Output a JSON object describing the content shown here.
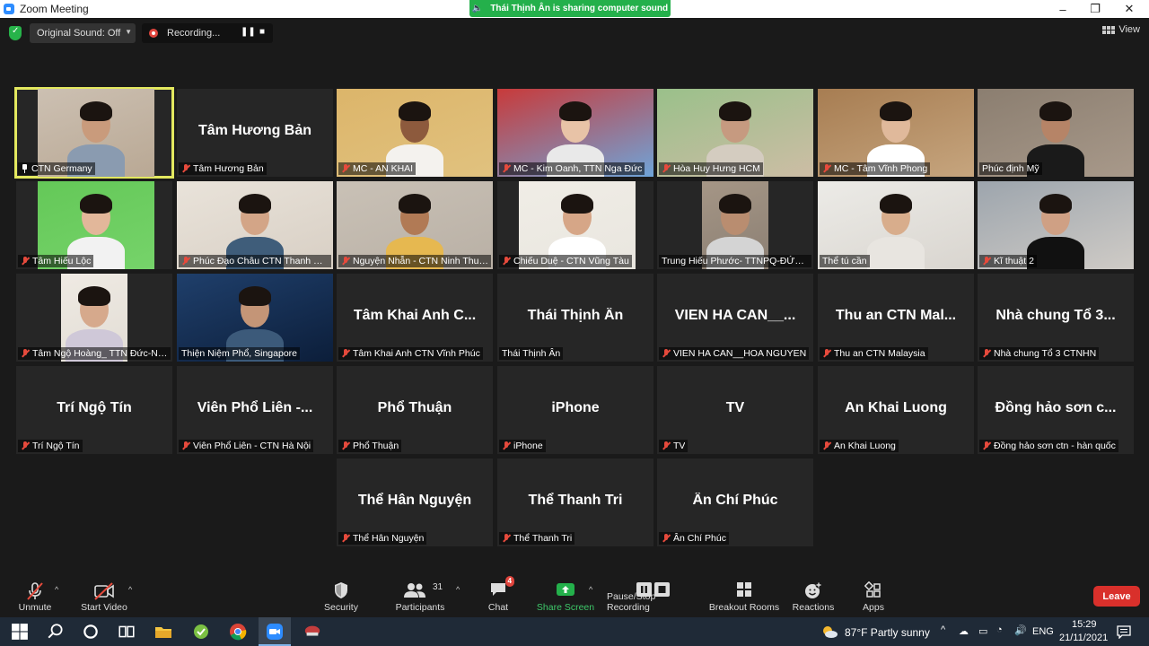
{
  "window": {
    "title": "Zoom Meeting",
    "minimize": "–",
    "maximize": "❐",
    "close": "✕"
  },
  "banner": {
    "text": "Thái Thịnh Ân is sharing computer sound"
  },
  "topbar": {
    "original_sound": "Original Sound: Off",
    "recording": "Recording...",
    "view": "View"
  },
  "participants": [
    {
      "name": "CTN Germany",
      "big": "",
      "video": true,
      "muted": false,
      "pinned": true,
      "active": true
    },
    {
      "name": "Tâm Hương Bản",
      "big": "Tâm Hương Bản",
      "video": false,
      "muted": true
    },
    {
      "name": "MC - AN KHAI",
      "big": "",
      "video": true,
      "muted": true
    },
    {
      "name": "MC - Kim Oanh, TTN Nga Đức",
      "big": "",
      "video": true,
      "muted": true
    },
    {
      "name": "Hòa Huy Hưng HCM",
      "big": "",
      "video": true,
      "muted": true
    },
    {
      "name": "MC - Tâm Vĩnh Phong",
      "big": "",
      "video": true,
      "muted": true
    },
    {
      "name": "Phúc định Mỹ",
      "big": "",
      "video": true,
      "muted": false
    },
    {
      "name": "Tâm Hiếu Lộc",
      "big": "",
      "video": true,
      "muted": true
    },
    {
      "name": "Phúc Đạo Châu CTN Thanh Hoá",
      "big": "",
      "video": true,
      "muted": true
    },
    {
      "name": "Nguyện Nhẫn - CTN Ninh Thuận",
      "big": "",
      "video": true,
      "muted": true
    },
    {
      "name": "Chiếu Duệ - CTN Vũng Tàu",
      "big": "",
      "video": true,
      "muted": true
    },
    {
      "name": "Trung Hiếu Phước- TTNPQ-ĐỨC N...",
      "big": "",
      "video": true,
      "muted": false
    },
    {
      "name": "Thể tú cần",
      "big": "",
      "video": true,
      "muted": false
    },
    {
      "name": "Kĩ thuật 2",
      "big": "",
      "video": true,
      "muted": true
    },
    {
      "name": "Tâm Ngộ Hoàng_ TTN Đức-Nga",
      "big": "",
      "video": true,
      "muted": true
    },
    {
      "name": "Thiện Niệm Phổ, Singapore",
      "big": "",
      "video": true,
      "muted": false
    },
    {
      "name": "Tâm Khai Anh CTN Vĩnh Phúc",
      "big": "Tâm Khai Anh C...",
      "video": false,
      "muted": true
    },
    {
      "name": "Thái Thịnh Ân",
      "big": "Thái Thịnh Ân",
      "video": false,
      "muted": false
    },
    {
      "name": "VIEN HA CAN__HOA NGUYEN",
      "big": "VIEN HA CAN__...",
      "video": false,
      "muted": true
    },
    {
      "name": "Thu an CTN Malaysia",
      "big": "Thu an CTN Mal...",
      "video": false,
      "muted": true
    },
    {
      "name": "Nhà chung Tổ 3 CTNHN",
      "big": "Nhà chung Tổ 3...",
      "video": false,
      "muted": true
    },
    {
      "name": "Trí Ngộ Tín",
      "big": "Trí Ngộ Tín",
      "video": false,
      "muted": true
    },
    {
      "name": "Viên Phổ Liên - CTN Hà Nội",
      "big": "Viên Phổ Liên -...",
      "video": false,
      "muted": true
    },
    {
      "name": "Phổ Thuận",
      "big": "Phổ Thuận",
      "video": false,
      "muted": true
    },
    {
      "name": "iPhone",
      "big": "iPhone",
      "video": false,
      "muted": true
    },
    {
      "name": "TV",
      "big": "TV",
      "video": false,
      "muted": true
    },
    {
      "name": "An Khai Luong",
      "big": "An Khai Luong",
      "video": false,
      "muted": true
    },
    {
      "name": "Đồng hảo sơn ctn - hàn quốc",
      "big": "Đồng hảo sơn c...",
      "video": false,
      "muted": true
    },
    {
      "name": "Thể Hân Nguyện",
      "big": "Thể Hân Nguyện",
      "video": false,
      "muted": true
    },
    {
      "name": "Thể Thanh Tri",
      "big": "Thể Thanh Tri",
      "video": false,
      "muted": true
    },
    {
      "name": "Ân Chí Phúc",
      "big": "Ân Chí Phúc",
      "video": false,
      "muted": true
    }
  ],
  "toolbar": {
    "unmute": "Unmute",
    "start_video": "Start Video",
    "security": "Security",
    "participants": "Participants",
    "participants_count": "31",
    "chat": "Chat",
    "chat_badge": "4",
    "share_screen": "Share Screen",
    "recording": "Pause/Stop Recording",
    "breakout": "Breakout Rooms",
    "reactions": "Reactions",
    "apps": "Apps",
    "leave": "Leave"
  },
  "taskbar": {
    "weather": "87°F  Partly sunny",
    "lang": "ENG",
    "time": "15:29",
    "date": "21/11/2021"
  },
  "colors": {
    "share_green": "#24b04b",
    "active_border": "#e3e85f",
    "leave_red": "#d9302b",
    "mute_red": "#e64a3c"
  }
}
